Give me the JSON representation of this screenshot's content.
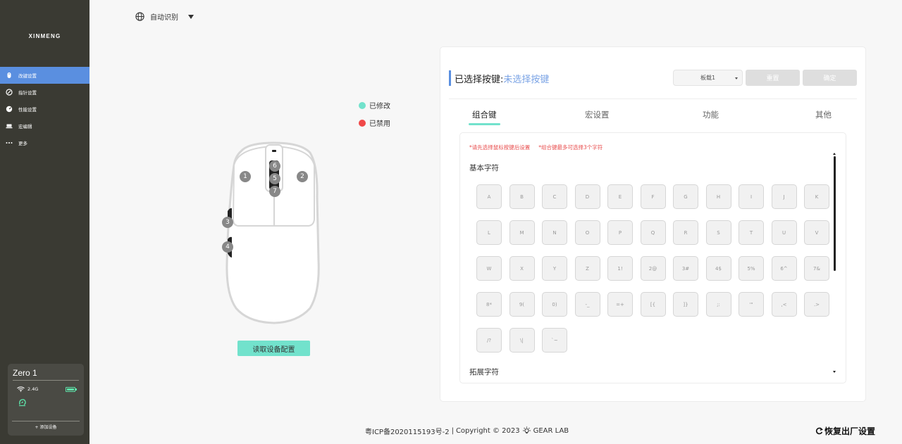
{
  "sidebar": {
    "brand": "XINMENG",
    "items": [
      {
        "label": "改键设置",
        "icon": "mouse-icon"
      },
      {
        "label": "指针设置",
        "icon": "pointer-icon"
      },
      {
        "label": "性能设置",
        "icon": "gauge-icon"
      },
      {
        "label": "宏编辑",
        "icon": "keyboard-icon"
      },
      {
        "label": "更多",
        "icon": "more-icon"
      }
    ],
    "device": {
      "name": "Zero 1",
      "connection": "2.4G",
      "battery_level": 1.0,
      "add_label": "+ 添加设备"
    }
  },
  "language": {
    "label": "自动识别"
  },
  "legend": {
    "modified": {
      "label": "已修改",
      "color": "#72e2cc"
    },
    "disabled": {
      "label": "已禁用",
      "color": "#f04848"
    }
  },
  "mouse": {
    "buttons": [
      "1",
      "2",
      "3",
      "4",
      "5",
      "6",
      "7"
    ]
  },
  "read_config_label": "读取设备配置",
  "panel": {
    "selected_label": "已选择按键:",
    "selected_value": "未选择按键",
    "profile_select": "板载1",
    "reset_label": "重置",
    "confirm_label": "确定",
    "tabs": [
      "组合键",
      "宏设置",
      "功能",
      "其他"
    ],
    "active_tab": "组合键",
    "tips": [
      "*请先选择鼠标按键后设置",
      "*组合键最多可选择3个字符"
    ],
    "basic_title": "基本字符",
    "extended_title": "拓展字符",
    "keys": [
      "A",
      "B",
      "C",
      "D",
      "E",
      "F",
      "G",
      "H",
      "I",
      "J",
      "K",
      "L",
      "M",
      "N",
      "O",
      "P",
      "Q",
      "R",
      "S",
      "T",
      "U",
      "V",
      "W",
      "X",
      "Y",
      "Z",
      "1!",
      "2@",
      "3#",
      "4$",
      "5%",
      "6^",
      "7&",
      "8*",
      "9(",
      "0)",
      "-_",
      "=+",
      "[{",
      "]}",
      ";:",
      "'\"",
      ",<",
      ".>",
      "/?",
      "\\|",
      "`~"
    ]
  },
  "footer": {
    "icp": "粤ICP备2020115193号-2",
    "separator": "|",
    "copyright": "Copyright © 2023",
    "brand": "GEAR LAB"
  },
  "factory_reset_label": "恢复出厂设置"
}
